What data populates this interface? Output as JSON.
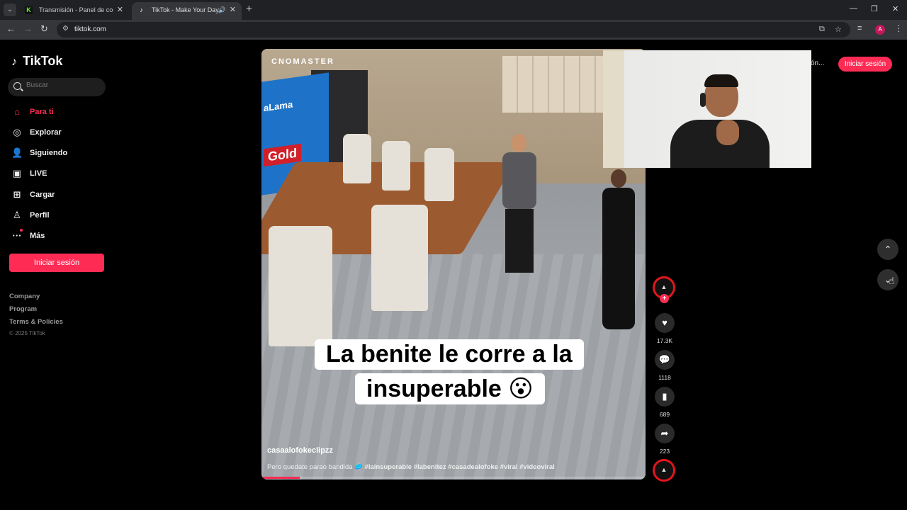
{
  "browser": {
    "tabs": [
      {
        "title": "Transmisión - Panel de control",
        "favicon": "K",
        "active": false
      },
      {
        "title": "TikTok - Make Your Day",
        "favicon": "♪",
        "active": true
      }
    ],
    "url": "tiktok.com",
    "profile_initial": "A"
  },
  "sidebar": {
    "brand": "TikTok",
    "search_placeholder": "Buscar",
    "items": [
      {
        "label": "Para ti",
        "icon": "home-icon",
        "active": true
      },
      {
        "label": "Explorar",
        "icon": "compass-icon"
      },
      {
        "label": "Siguiendo",
        "icon": "following-icon"
      },
      {
        "label": "LIVE",
        "icon": "live-icon"
      },
      {
        "label": "Cargar",
        "icon": "upload-icon"
      },
      {
        "label": "Perfil",
        "icon": "profile-icon"
      },
      {
        "label": "Más",
        "icon": "more-icon"
      }
    ],
    "login_label": "Iniciar sesión",
    "footer_links": [
      "Company",
      "Program",
      "Terms & Policies"
    ],
    "copyright": "© 2025 TikTok"
  },
  "header": {
    "partial_text": "ón...",
    "login_label": "Iniciar sesión"
  },
  "video": {
    "channel_watermark": "CNOMASTER",
    "caption_line1": "La benite le corre a la",
    "caption_line2": "insuperable 😮",
    "author": "casaalofokeclipzz",
    "description": "Pero quedate parao bandida 🥏",
    "hashtags": "#lainsuperable #labenitez #casadealofoke #viral #videoviral",
    "progress": 0.1
  },
  "actions": {
    "likes": "17.3K",
    "comments": "1118",
    "saves": "689",
    "shares": "223"
  },
  "colors": {
    "accent": "#fe2c55",
    "background": "#000000",
    "ring": "#e0161e"
  }
}
